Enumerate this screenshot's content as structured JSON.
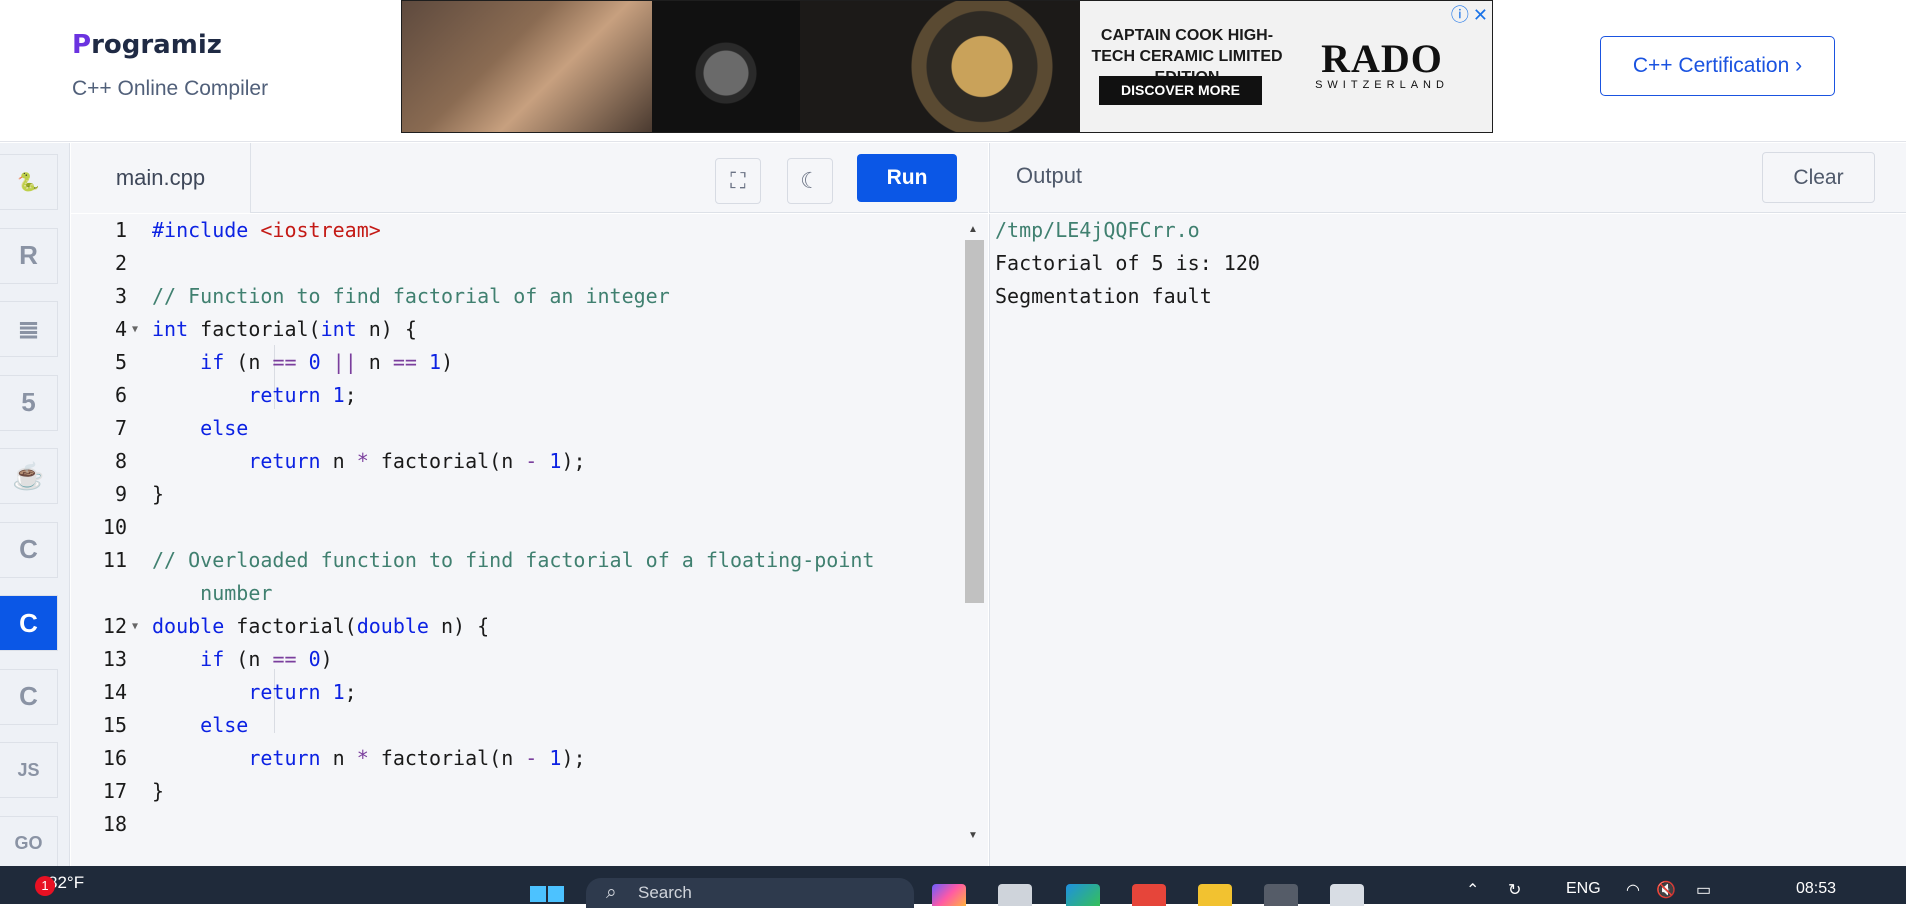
{
  "header": {
    "logo_text": "rogramiz",
    "logo_mark": "P",
    "subtitle": "C++ Online Compiler",
    "certification_label": "C++ Certification ›"
  },
  "ad": {
    "headline": "CAPTAIN COOK HIGH-TECH CERAMIC LIMITED EDITION",
    "cta": "DISCOVER MORE",
    "brand": "RADO",
    "brand_sub": "SWITZERLAND",
    "info_icon": "ⓘ",
    "close_icon": "✕"
  },
  "sidebar": {
    "items": [
      {
        "name": "python",
        "icon": "python-icon",
        "glyph": "🐍",
        "active": false
      },
      {
        "name": "r",
        "icon": "r-icon",
        "glyph": "R",
        "active": false
      },
      {
        "name": "sql",
        "icon": "database-icon",
        "glyph": "≣",
        "active": false
      },
      {
        "name": "html",
        "icon": "html5-icon",
        "glyph": "5",
        "active": false
      },
      {
        "name": "java",
        "icon": "java-icon",
        "glyph": "☕",
        "active": false
      },
      {
        "name": "c",
        "icon": "c-icon",
        "glyph": "C",
        "active": false
      },
      {
        "name": "cpp",
        "icon": "cpp-icon",
        "glyph": "C",
        "active": true
      },
      {
        "name": "csharp",
        "icon": "csharp-icon",
        "glyph": "C",
        "active": false
      },
      {
        "name": "js",
        "icon": "js-icon",
        "glyph": "JS",
        "active": false
      },
      {
        "name": "go",
        "icon": "go-icon",
        "glyph": "GO",
        "active": false
      }
    ]
  },
  "editor": {
    "file_name": "main.cpp",
    "fullscreen_icon": "⛶",
    "theme_icon": "☾",
    "run_label": "Run",
    "lines": [
      {
        "n": "1",
        "html": "<span class=\"inc\">#include</span> <span class=\"str\">&lt;iostream&gt;</span>"
      },
      {
        "n": "2",
        "html": ""
      },
      {
        "n": "3",
        "html": "<span class=\"cm\">// Function to find factorial of an integer</span>"
      },
      {
        "n": "4",
        "fold": true,
        "html": "<span class=\"kw\">int</span> factorial(<span class=\"kw\">int</span> n) {"
      },
      {
        "n": "5",
        "html": "    <span class=\"kw\">if</span> (n <span class=\"op\">==</span> <span class=\"num\">0</span> <span class=\"op\">||</span> n <span class=\"op\">==</span> <span class=\"num\">1</span>)"
      },
      {
        "n": "6",
        "html": "        <span class=\"kw\">return</span> <span class=\"num\">1</span>;"
      },
      {
        "n": "7",
        "html": "    <span class=\"kw\">else</span>"
      },
      {
        "n": "8",
        "html": "        <span class=\"kw\">return</span> n <span class=\"op\">*</span> factorial(n <span class=\"op\">-</span> <span class=\"num\">1</span>);"
      },
      {
        "n": "9",
        "html": "}"
      },
      {
        "n": "10",
        "html": ""
      },
      {
        "n": "11",
        "html": "<span class=\"cm\">// Overloaded function to find factorial of a floating-point</span>"
      },
      {
        "n": "",
        "html": "    <span class=\"cm\">number</span>"
      },
      {
        "n": "12",
        "fold": true,
        "html": "<span class=\"kw\">double</span> factorial(<span class=\"kw\">double</span> n) {"
      },
      {
        "n": "13",
        "html": "    <span class=\"kw\">if</span> (n <span class=\"op\">==</span> <span class=\"num\">0</span>)"
      },
      {
        "n": "14",
        "html": "        <span class=\"kw\">return</span> <span class=\"num\">1</span>;"
      },
      {
        "n": "15",
        "html": "    <span class=\"kw\">else</span>"
      },
      {
        "n": "16",
        "html": "        <span class=\"kw\">return</span> n <span class=\"op\">*</span> factorial(n <span class=\"op\">-</span> <span class=\"num\">1</span>);"
      },
      {
        "n": "17",
        "html": "}"
      },
      {
        "n": "18",
        "html": ""
      }
    ]
  },
  "output": {
    "title": "Output",
    "clear_label": "Clear",
    "lines": [
      {
        "text": "/tmp/LE4jQQFCrr.o",
        "type": "path"
      },
      {
        "text": "Factorial of 5 is: 120",
        "type": "stdout"
      },
      {
        "text": "Segmentation fault",
        "type": "stdout"
      }
    ]
  },
  "taskbar": {
    "weather": "82°F",
    "weather_badge": "1",
    "search_placeholder": "Search",
    "language": "ENG",
    "time": "08:53"
  }
}
